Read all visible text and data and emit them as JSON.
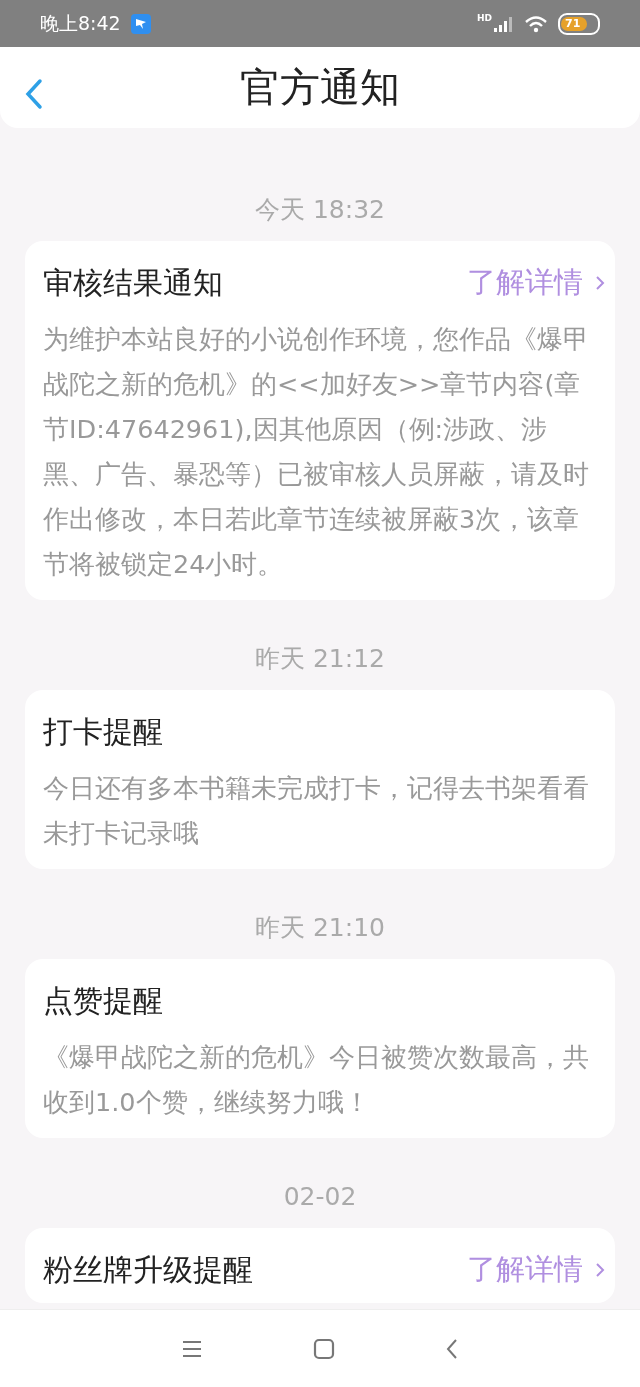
{
  "status_bar": {
    "time": "晚上8:42",
    "network": "HD",
    "battery": "71"
  },
  "header": {
    "title": "官方通知"
  },
  "notifications": [
    {
      "time": "今天 18:32",
      "title": "审核结果通知",
      "link": "了解详情",
      "body": "为维护本站良好的小说创作环境，您作品《爆甲战陀之新的危机》的<<加好友>>章节内容(章节ID:47642961),因其他原因（例:涉政、涉黑、广告、暴恐等）已被审核人员屏蔽，请及时作出修改，本日若此章节连续被屏蔽3次，该章节将被锁定24小时。"
    },
    {
      "time": "昨天 21:12",
      "title": "打卡提醒",
      "body": "今日还有多本书籍未完成打卡，记得去书架看看未打卡记录哦"
    },
    {
      "time": "昨天 21:10",
      "title": "点赞提醒",
      "body": "《爆甲战陀之新的危机》今日被赞次数最高，共收到1.0个赞，继续努力哦！"
    },
    {
      "time": "02-02",
      "title": "粉丝牌升级提醒",
      "link": "了解详情"
    }
  ]
}
